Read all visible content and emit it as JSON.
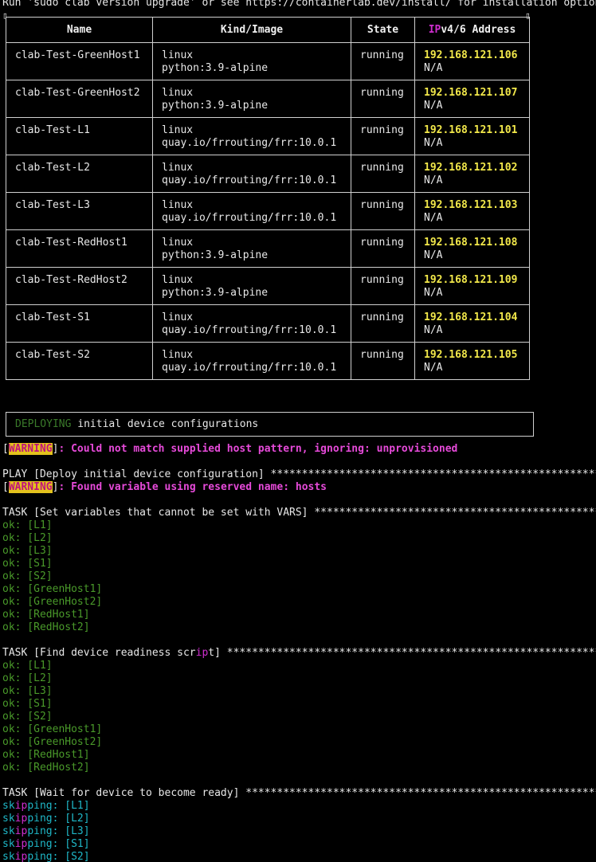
{
  "header_line": "Run 'sudo clab version upgrade' or see https://containerlab.dev/install/ for installation options.",
  "table": {
    "headers": {
      "name": "Name",
      "kind": "Kind/Image",
      "state": "State",
      "ip_prefix": "IP",
      "ip_rest": "v4/6 Address"
    },
    "rows": [
      {
        "name": "clab-Test-GreenHost1",
        "kind": "linux",
        "image": "python:3.9-alpine",
        "state": "running",
        "ipv4": "192.168.121.106",
        "ipv6": "N/A"
      },
      {
        "name": "clab-Test-GreenHost2",
        "kind": "linux",
        "image": "python:3.9-alpine",
        "state": "running",
        "ipv4": "192.168.121.107",
        "ipv6": "N/A"
      },
      {
        "name": "clab-Test-L1",
        "kind": "linux",
        "image": "quay.io/frrouting/frr:10.0.1",
        "state": "running",
        "ipv4": "192.168.121.101",
        "ipv6": "N/A"
      },
      {
        "name": "clab-Test-L2",
        "kind": "linux",
        "image": "quay.io/frrouting/frr:10.0.1",
        "state": "running",
        "ipv4": "192.168.121.102",
        "ipv6": "N/A"
      },
      {
        "name": "clab-Test-L3",
        "kind": "linux",
        "image": "quay.io/frrouting/frr:10.0.1",
        "state": "running",
        "ipv4": "192.168.121.103",
        "ipv6": "N/A"
      },
      {
        "name": "clab-Test-RedHost1",
        "kind": "linux",
        "image": "python:3.9-alpine",
        "state": "running",
        "ipv4": "192.168.121.108",
        "ipv6": "N/A"
      },
      {
        "name": "clab-Test-RedHost2",
        "kind": "linux",
        "image": "python:3.9-alpine",
        "state": "running",
        "ipv4": "192.168.121.109",
        "ipv6": "N/A"
      },
      {
        "name": "clab-Test-S1",
        "kind": "linux",
        "image": "quay.io/frrouting/frr:10.0.1",
        "state": "running",
        "ipv4": "192.168.121.104",
        "ipv6": "N/A"
      },
      {
        "name": "clab-Test-S2",
        "kind": "linux",
        "image": "quay.io/frrouting/frr:10.0.1",
        "state": "running",
        "ipv4": "192.168.121.105",
        "ipv6": "N/A"
      }
    ]
  },
  "deploy_banner": {
    "word": "DEPLOYING",
    "rest": " initial device configurations"
  },
  "warning1": {
    "tag": "WARNING",
    "msg": ": Could not match supplied host pattern, ignoring: unprovisioned"
  },
  "play_line": "PLAY [Deploy initial device configuration] *************************************************************",
  "warning2": {
    "tag": "WARNING",
    "msg": ": Found variable using reserved name: hosts"
  },
  "task1": "TASK [Set variables that cannot be set with VARS] *********************************************************",
  "task1_results": [
    "ok: [L1]",
    "ok: [L2]",
    "ok: [L3]",
    "ok: [S1]",
    "ok: [S2]",
    "ok: [GreenHost1]",
    "ok: [GreenHost2]",
    "ok: [RedHost1]",
    "ok: [RedHost2]"
  ],
  "task2": {
    "a": "TASK [Find device readiness scr",
    "b": "ip",
    "c": "t] ******************************************************************"
  },
  "task2_results": [
    "ok: [L1]",
    "ok: [L2]",
    "ok: [L3]",
    "ok: [S1]",
    "ok: [S2]",
    "ok: [GreenHost1]",
    "ok: [GreenHost2]",
    "ok: [RedHost1]",
    "ok: [RedHost2]"
  ],
  "task3": "TASK [Wait for device to become ready] *******************************************************************",
  "task3_results": [
    {
      "a": "sk",
      "b": "ip",
      "c": "ping: [L1]"
    },
    {
      "a": "sk",
      "b": "ip",
      "c": "ping: [L2]"
    },
    {
      "a": "sk",
      "b": "ip",
      "c": "ping: [L3]"
    },
    {
      "a": "sk",
      "b": "ip",
      "c": "ping: [S1]"
    },
    {
      "a": "sk",
      "b": "ip",
      "c": "ping: [S2]"
    }
  ],
  "colors": {
    "ok": "#4a9a2a",
    "skipping": "#1fb8c8",
    "magenta": "#d02ed0",
    "warning_bg": "#e3c21d",
    "ip_yellow": "#f2e84a"
  }
}
